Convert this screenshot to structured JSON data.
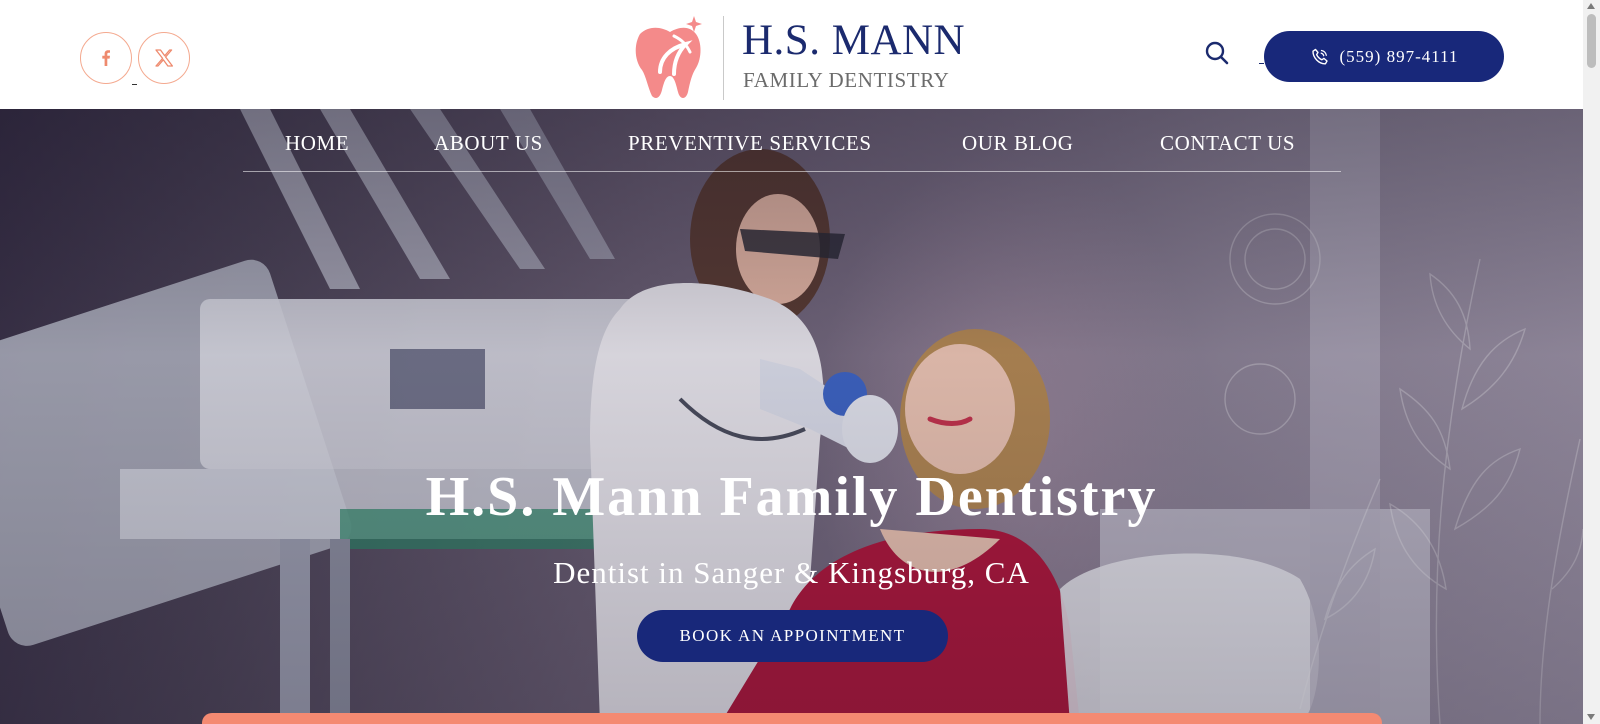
{
  "header": {
    "logo": {
      "name": "H.S. MANN",
      "subtitle": "FAMILY DENTISTRY",
      "icon": "tooth-logo-icon",
      "brand_color": "#f48a8a"
    },
    "social": [
      {
        "network": "facebook",
        "icon": "facebook-icon"
      },
      {
        "network": "x",
        "icon": "x-icon"
      }
    ],
    "search_icon": "search-icon",
    "phone": {
      "number": "(559) 897-4111",
      "icon": "phone-icon"
    }
  },
  "nav": {
    "items": [
      {
        "label": "HOME"
      },
      {
        "label": "ABOUT US"
      },
      {
        "label": "PREVENTIVE SERVICES"
      },
      {
        "label": "OUR BLOG"
      },
      {
        "label": "CONTACT US"
      }
    ]
  },
  "hero": {
    "title": "H.S. Mann Family Dentistry",
    "subtitle": "Dentist in Sanger & Kingsburg, CA",
    "cta_label": "BOOK AN APPOINTMENT"
  },
  "colors": {
    "primary": "#18287a",
    "accent": "#f48a72",
    "social_border": "#f4a98f"
  }
}
